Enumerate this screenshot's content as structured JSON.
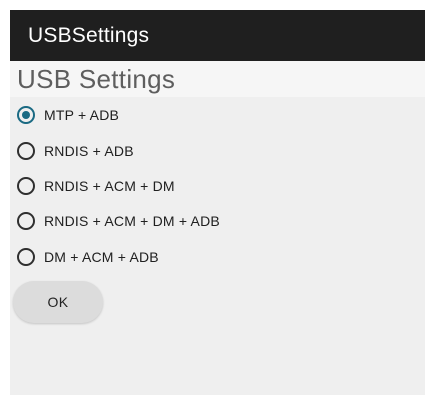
{
  "app_bar": {
    "title": "USBSettings",
    "background": "#1f1f1f"
  },
  "page": {
    "title": "USB Settings"
  },
  "options": [
    {
      "label": "MTP + ADB",
      "selected": true
    },
    {
      "label": "RNDIS + ADB",
      "selected": false
    },
    {
      "label": "RNDIS + ACM + DM",
      "selected": false
    },
    {
      "label": "RNDIS + ACM + DM + ADB",
      "selected": false
    },
    {
      "label": "DM + ACM + ADB",
      "selected": false
    }
  ],
  "actions": {
    "ok_label": "OK"
  },
  "colors": {
    "accent": "#1a6a83",
    "content_background": "#efefef"
  }
}
